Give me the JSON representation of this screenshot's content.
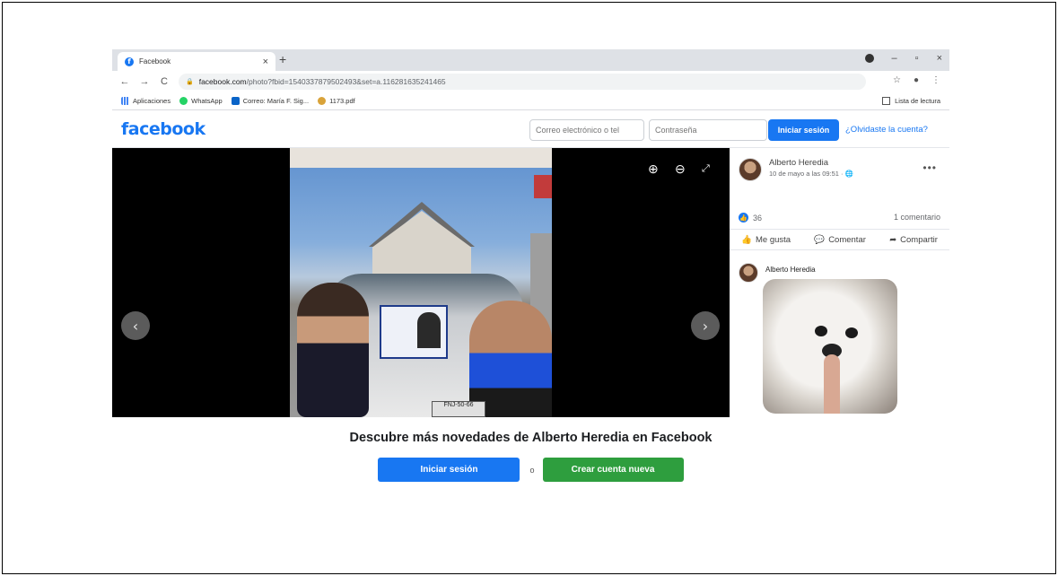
{
  "browser": {
    "tab_title": "Facebook",
    "tab_close": "×",
    "new_tab": "+",
    "url_host": "facebook.com",
    "url_rest": "/photo?fbid=1540337879502493&set=a.116281635241465",
    "window_minimize": "–",
    "window_restore": "▫",
    "window_close": "×"
  },
  "bookmarks": {
    "items": [
      "Aplicaciones",
      "WhatsApp",
      "Correo: María F. Sig...",
      "1173.pdf"
    ],
    "reading_list": "Lista de lectura"
  },
  "header": {
    "logo": "facebook",
    "email_placeholder": "Correo electrónico o tel",
    "password_placeholder": "Contraseña",
    "login_label": "Iniciar sesión",
    "forgot_label": "¿Olvidaste la cuenta?"
  },
  "viewer": {
    "plate_text": "FNJ-50-66"
  },
  "post": {
    "author": "Alberto Heredia",
    "date": "10 de mayo a las 09:51 · ",
    "likes_count": "36",
    "comments_count": "1 comentario",
    "actions": [
      "Me gusta",
      "Comentar",
      "Compartir"
    ],
    "comment_author": "Alberto Heredia"
  },
  "banner": {
    "title": "Descubre más novedades de Alberto Heredia en Facebook",
    "login_label": "Iniciar sesión",
    "or_label": "o",
    "create_label": "Crear cuenta nueva"
  }
}
